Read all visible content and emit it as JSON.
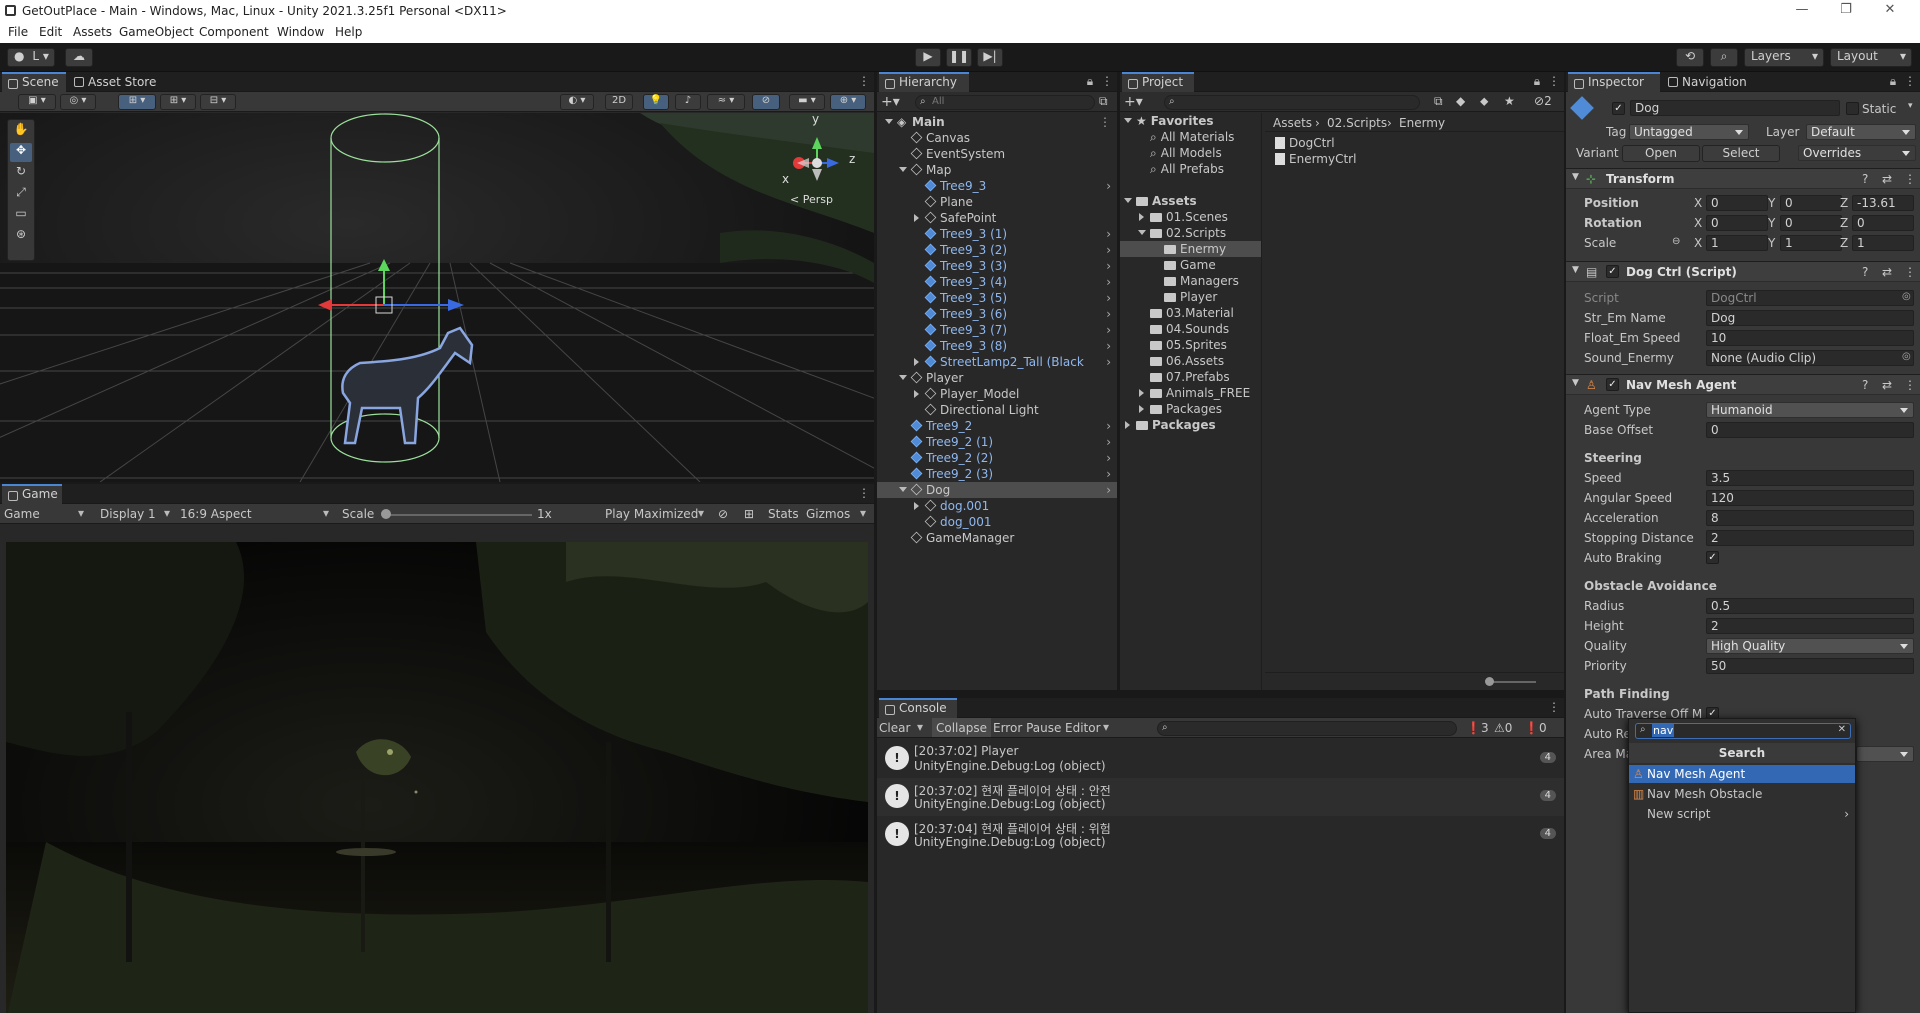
{
  "window": {
    "title": "GetOutPlace - Main - Windows, Mac, Linux - Unity 2021.3.25f1 Personal <DX11>",
    "controls": [
      "—",
      "❐",
      "✕"
    ]
  },
  "menu": [
    "File",
    "Edit",
    "Assets",
    "GameObject",
    "Component",
    "Window",
    "Help"
  ],
  "toolbar": {
    "account_label": "L",
    "layers_label": "Layers",
    "layout_label": "Layout"
  },
  "scene": {
    "tabs": [
      "Scene",
      "Asset Store"
    ],
    "mode_2d": "2D",
    "persp_label": "< Persp",
    "gizmo_axes": {
      "x": "x",
      "y": "y",
      "z": "z"
    }
  },
  "game": {
    "tab": "Game",
    "display_select": "Game",
    "display": "Display 1",
    "aspect": "16:9 Aspect",
    "scale_label": "Scale",
    "scale_value": "1x",
    "play_mode": "Play Maximized",
    "stats": "Stats",
    "gizmos": "Gizmos"
  },
  "hierarchy": {
    "tab": "Hierarchy",
    "search_placeholder": "All",
    "items": [
      {
        "label": "Main",
        "depth": 0,
        "kind": "scene",
        "expanded": true
      },
      {
        "label": "Canvas",
        "depth": 1,
        "kind": "go"
      },
      {
        "label": "EventSystem",
        "depth": 1,
        "kind": "go"
      },
      {
        "label": "Map",
        "depth": 1,
        "kind": "go",
        "expanded": true
      },
      {
        "label": "Tree9_3",
        "depth": 2,
        "kind": "prefab",
        "more": true
      },
      {
        "label": "Plane",
        "depth": 2,
        "kind": "go"
      },
      {
        "label": "SafePoint",
        "depth": 2,
        "kind": "go",
        "collapsed": true
      },
      {
        "label": "Tree9_3 (1)",
        "depth": 2,
        "kind": "prefab",
        "more": true
      },
      {
        "label": "Tree9_3 (2)",
        "depth": 2,
        "kind": "prefab",
        "more": true
      },
      {
        "label": "Tree9_3 (3)",
        "depth": 2,
        "kind": "prefab",
        "more": true
      },
      {
        "label": "Tree9_3 (4)",
        "depth": 2,
        "kind": "prefab",
        "more": true
      },
      {
        "label": "Tree9_3 (5)",
        "depth": 2,
        "kind": "prefab",
        "more": true
      },
      {
        "label": "Tree9_3 (6)",
        "depth": 2,
        "kind": "prefab",
        "more": true
      },
      {
        "label": "Tree9_3 (7)",
        "depth": 2,
        "kind": "prefab",
        "more": true
      },
      {
        "label": "Tree9_3 (8)",
        "depth": 2,
        "kind": "prefab",
        "more": true
      },
      {
        "label": "StreetLamp2_Tall (Black",
        "depth": 2,
        "kind": "prefab",
        "collapsed": true,
        "more": true
      },
      {
        "label": "Player",
        "depth": 1,
        "kind": "go",
        "expanded": true
      },
      {
        "label": "Player_Model",
        "depth": 2,
        "kind": "go",
        "collapsed": true
      },
      {
        "label": "Directional Light",
        "depth": 2,
        "kind": "go"
      },
      {
        "label": "Tree9_2",
        "depth": 1,
        "kind": "prefab",
        "more": true
      },
      {
        "label": "Tree9_2 (1)",
        "depth": 1,
        "kind": "prefab",
        "more": true
      },
      {
        "label": "Tree9_2 (2)",
        "depth": 1,
        "kind": "prefab",
        "more": true
      },
      {
        "label": "Tree9_2 (3)",
        "depth": 1,
        "kind": "prefab",
        "more": true
      },
      {
        "label": "Dog",
        "depth": 1,
        "kind": "go",
        "expanded": true,
        "selected": true,
        "more": true
      },
      {
        "label": "dog.001",
        "depth": 2,
        "kind": "go",
        "collapsed": true,
        "prefabtext": true
      },
      {
        "label": "dog_001",
        "depth": 2,
        "kind": "go",
        "prefabtext": true
      },
      {
        "label": "GameManager",
        "depth": 1,
        "kind": "go"
      }
    ]
  },
  "project": {
    "tab": "Project",
    "breadcrumb": [
      "Assets",
      "02.Scripts",
      "Enermy"
    ],
    "hidden_count": "2",
    "tree": [
      {
        "label": "Favorites",
        "depth": 0,
        "kind": "star",
        "expanded": true,
        "bold": true
      },
      {
        "label": "All Materials",
        "depth": 1,
        "kind": "search"
      },
      {
        "label": "All Models",
        "depth": 1,
        "kind": "search"
      },
      {
        "label": "All Prefabs",
        "depth": 1,
        "kind": "search"
      },
      {
        "label": "",
        "depth": 0,
        "kind": "blank"
      },
      {
        "label": "Assets",
        "depth": 0,
        "kind": "folder",
        "expanded": true,
        "bold": true
      },
      {
        "label": "01.Scenes",
        "depth": 1,
        "kind": "folder",
        "collapsed": true
      },
      {
        "label": "02.Scripts",
        "depth": 1,
        "kind": "folder",
        "expanded": true
      },
      {
        "label": "Enermy",
        "depth": 2,
        "kind": "folder",
        "selected": true
      },
      {
        "label": "Game",
        "depth": 2,
        "kind": "folder"
      },
      {
        "label": "Managers",
        "depth": 2,
        "kind": "folder"
      },
      {
        "label": "Player",
        "depth": 2,
        "kind": "folder"
      },
      {
        "label": "03.Material",
        "depth": 1,
        "kind": "folder"
      },
      {
        "label": "04.Sounds",
        "depth": 1,
        "kind": "folder"
      },
      {
        "label": "05.Sprites",
        "depth": 1,
        "kind": "folder"
      },
      {
        "label": "06.Assets",
        "depth": 1,
        "kind": "folder"
      },
      {
        "label": "07.Prefabs",
        "depth": 1,
        "kind": "folder"
      },
      {
        "label": "Animals_FREE",
        "depth": 1,
        "kind": "folder",
        "collapsed": true
      },
      {
        "label": "Packages",
        "depth": 1,
        "kind": "folder",
        "collapsed": true
      },
      {
        "label": "Packages",
        "depth": 0,
        "kind": "folder",
        "collapsed": true,
        "bold": true
      }
    ],
    "files": [
      "DogCtrl",
      "EnermyCtrl"
    ]
  },
  "console": {
    "tab": "Console",
    "clear": "Clear",
    "collapse": "Collapse",
    "error_pause": "Error Pause",
    "editor": "Editor",
    "counts": {
      "log": "3",
      "warn": "0",
      "error": "0"
    },
    "entries": [
      {
        "line1": "[20:37:02] Player",
        "line2": "UnityEngine.Debug:Log (object)",
        "count": "4"
      },
      {
        "line1": "[20:37:02] 현재 플레이어 상태 : 안전",
        "line2": "UnityEngine.Debug:Log (object)",
        "count": "4"
      },
      {
        "line1": "[20:37:04] 현재 플레이어 상태 : 위험",
        "line2": "UnityEngine.Debug:Log (object)",
        "count": "4"
      }
    ]
  },
  "inspector": {
    "tabs": [
      "Inspector",
      "Navigation"
    ],
    "object_name": "Dog",
    "static_label": "Static",
    "tag_label": "Tag",
    "tag_value": "Untagged",
    "layer_label": "Layer",
    "layer_value": "Default",
    "variant_label": "Variant",
    "open": "Open",
    "select": "Select",
    "overrides": "Overrides",
    "transform": {
      "title": "Transform",
      "position_label": "Position",
      "rotation_label": "Rotation",
      "scale_label": "Scale",
      "axes": [
        "X",
        "Y",
        "Z"
      ],
      "position": [
        "0",
        "0",
        "-13.61"
      ],
      "rotation": [
        "0",
        "0",
        "0"
      ],
      "scale": [
        "1",
        "1",
        "1"
      ]
    },
    "dogctrl": {
      "title": "Dog Ctrl (Script)",
      "fields": [
        {
          "label": "Script",
          "value": "DogCtrl"
        },
        {
          "label": "Str_Em Name",
          "value": "Dog"
        },
        {
          "label": "Float_Em Speed",
          "value": "10"
        },
        {
          "label": "Sound_Enermy",
          "value": "None (Audio Clip)"
        }
      ]
    },
    "navmesh": {
      "title": "Nav Mesh Agent",
      "agent_type_label": "Agent Type",
      "agent_type": "Humanoid",
      "base_offset_label": "Base Offset",
      "base_offset": "0",
      "steering": "Steering",
      "speed_label": "Speed",
      "speed": "3.5",
      "angular_label": "Angular Speed",
      "angular": "120",
      "accel_label": "Acceleration",
      "accel": "8",
      "stopping_label": "Stopping Distance",
      "stopping": "2",
      "braking_label": "Auto Braking",
      "obstacle": "Obstacle Avoidance",
      "radius_label": "Radius",
      "radius": "0.5",
      "height_label": "Height",
      "height": "2",
      "quality_label": "Quality",
      "quality": "High Quality",
      "priority_label": "Priority",
      "priority": "50",
      "pathfinding": "Path Finding",
      "traverse_label": "Auto Traverse Off Me",
      "repath_label": "Auto Re",
      "area_label": "Area Ma"
    },
    "popup": {
      "search_value": "nav",
      "heading": "Search",
      "items": [
        "Nav Mesh Agent",
        "Nav Mesh Obstacle",
        "New script"
      ]
    }
  },
  "colors": {
    "accent": "#4a86d6",
    "selection": "#2c5d87",
    "popup_highlight": "#3268b4"
  }
}
